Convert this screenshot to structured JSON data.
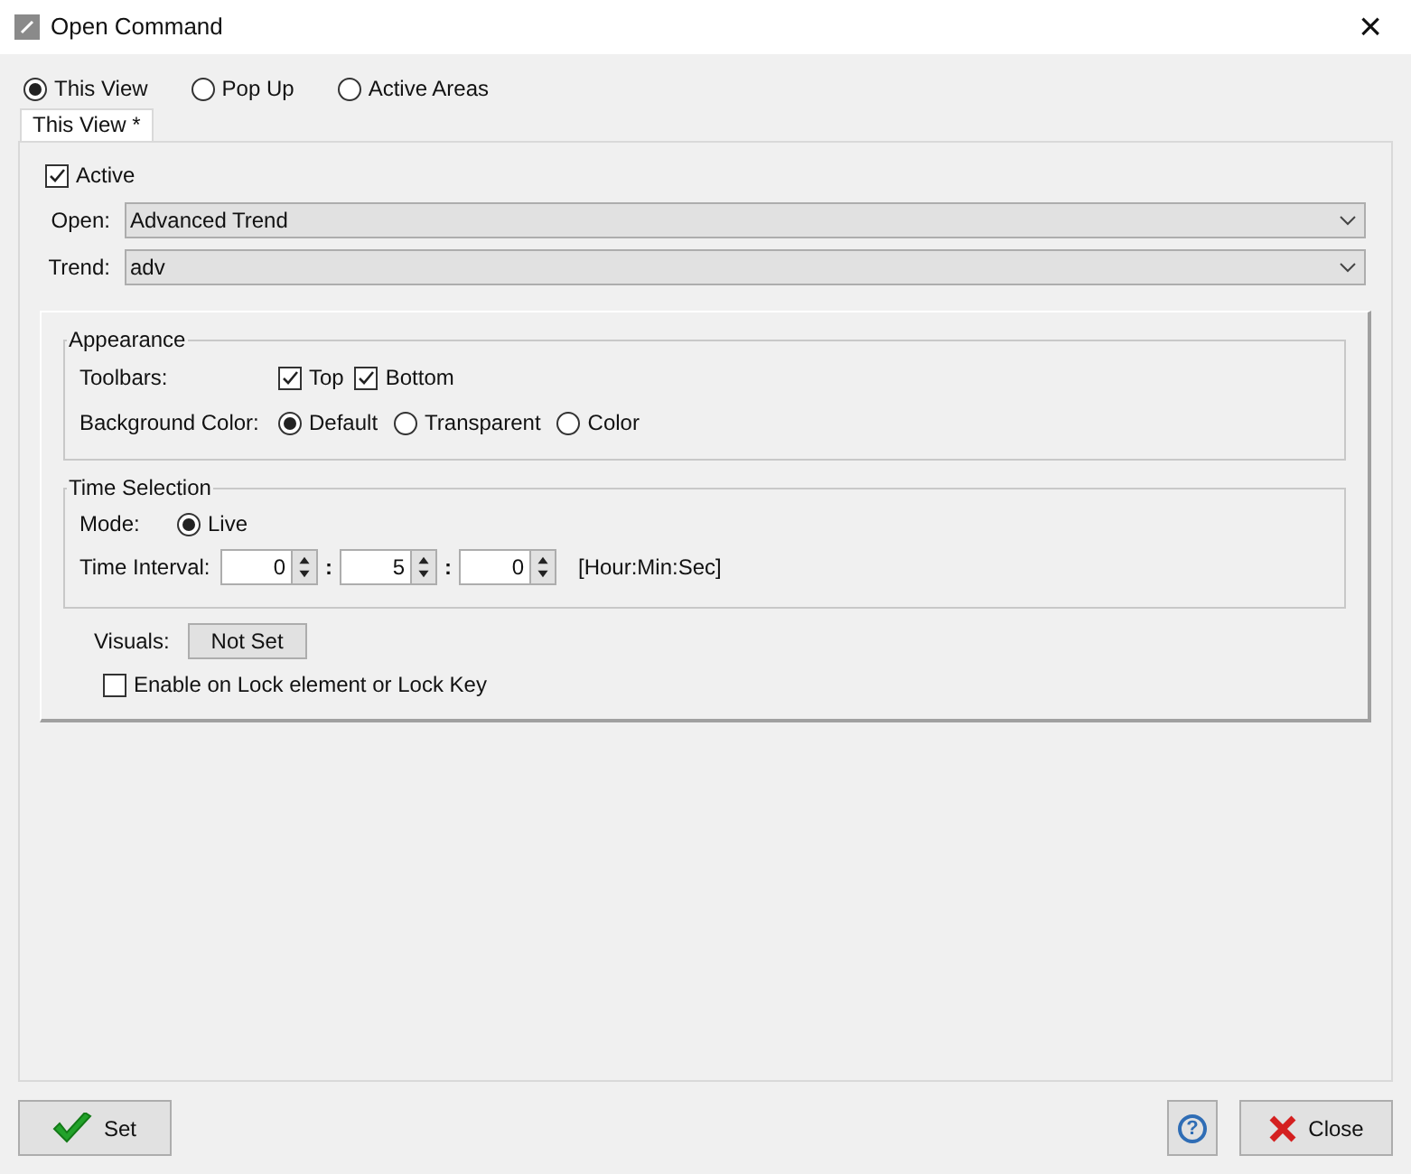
{
  "window": {
    "title": "Open Command",
    "close": "×"
  },
  "mode_options": [
    {
      "label": "This View",
      "selected": true
    },
    {
      "label": "Pop Up",
      "selected": false
    },
    {
      "label": "Active Areas",
      "selected": false
    }
  ],
  "tab": {
    "label": "This View *"
  },
  "active": {
    "label": "Active",
    "checked": true
  },
  "open": {
    "label": "Open:",
    "value": "Advanced Trend"
  },
  "trend": {
    "label": "Trend:",
    "value": "adv"
  },
  "appearance": {
    "title": "Appearance",
    "toolbars_label": "Toolbars:",
    "toolbars": [
      {
        "label": "Top",
        "checked": true
      },
      {
        "label": "Bottom",
        "checked": true
      }
    ],
    "background_label": "Background Color:",
    "background": [
      {
        "label": "Default",
        "selected": true
      },
      {
        "label": "Transparent",
        "selected": false
      },
      {
        "label": "Color",
        "selected": false
      }
    ]
  },
  "time_selection": {
    "title": "Time Selection",
    "mode_label": "Mode:",
    "modes": [
      {
        "label": "Live",
        "selected": true
      }
    ],
    "interval_label": "Time Interval:",
    "interval": [
      "0",
      "5",
      "0"
    ],
    "separator": ":",
    "format": "[Hour:Min:Sec]"
  },
  "visuals": {
    "label": "Visuals:",
    "button": "Not Set"
  },
  "lock": {
    "label": "Enable on Lock element or Lock Key",
    "checked": false
  },
  "buttons": {
    "set": "Set",
    "help": "?",
    "close": "Close"
  }
}
